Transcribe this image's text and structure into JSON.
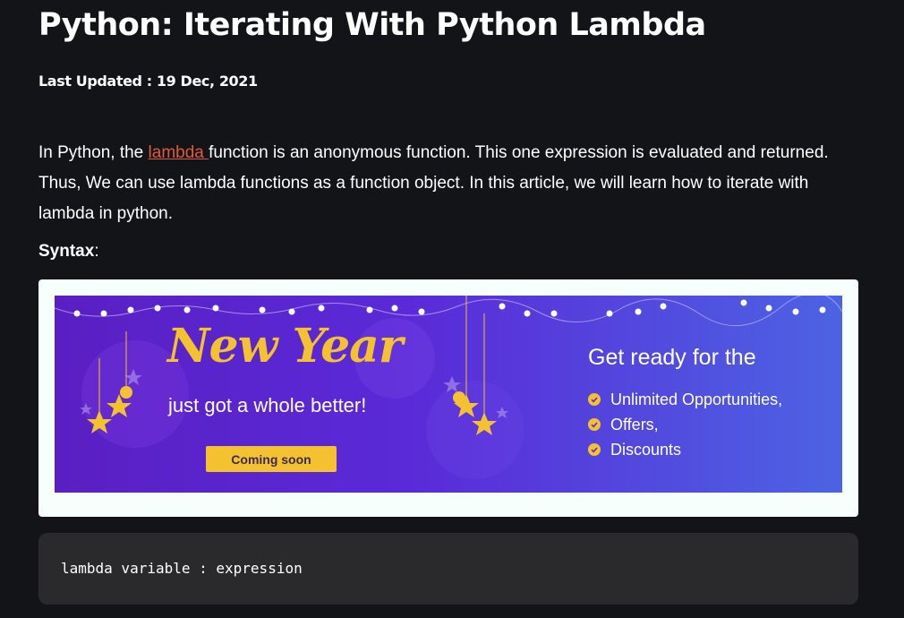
{
  "article": {
    "title": "Python: Iterating With Python Lambda",
    "last_updated": "Last Updated : 19 Dec, 2021",
    "intro": {
      "part1": "In Python, the ",
      "link": "lambda ",
      "part2": "function is an anonymous function. This one expression is evaluated and returned. Thus, We can use lambda functions as a function object. In this article, we will learn how to iterate with lambda in python."
    },
    "syntax_label": "Syntax",
    "syntax_colon": ":",
    "code": "lambda variable : expression"
  },
  "ad": {
    "headline": "New Year",
    "subline": "just got a whole better!",
    "button": "Coming soon",
    "ready": "Get ready for the",
    "benefits": [
      "Unlimited Opportunities,",
      "Offers,",
      "Discounts"
    ]
  },
  "colors": {
    "background": "#131417",
    "link": "#e05a3a",
    "banner_gold": "#f4c12f",
    "banner_purple": "#5a1fc3",
    "code_bg": "#2a2a2c"
  }
}
